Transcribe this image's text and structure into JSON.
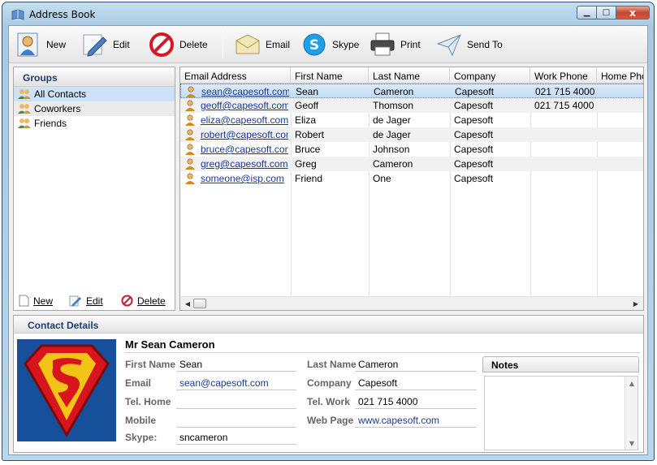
{
  "window": {
    "title": "Address Book"
  },
  "window_controls": {
    "minimize": "▁",
    "maximize": "□",
    "close": "x"
  },
  "toolbar": {
    "new_label": "New",
    "edit_label": "Edit",
    "delete_label": "Delete",
    "email_label": "Email",
    "skype_label": "Skype",
    "print_label": "Print",
    "sendto_label": "Send To"
  },
  "groups": {
    "title": "Groups",
    "items": [
      {
        "label": "All Contacts"
      },
      {
        "label": "Coworkers"
      },
      {
        "label": "Friends"
      }
    ],
    "actions": {
      "new_label": "New",
      "edit_label": "Edit",
      "delete_label": "Delete"
    }
  },
  "contacts": {
    "columns": [
      "Email Address",
      "First Name",
      "Last Name",
      "Company",
      "Work Phone",
      "Home Phone"
    ],
    "rows": [
      {
        "email": "sean@capesoft.com",
        "first": "Sean",
        "last": "Cameron",
        "company": "Capesoft",
        "work": "021 715 4000",
        "home": ""
      },
      {
        "email": "geoff@capesoft.com",
        "first": "Geoff",
        "last": "Thomson",
        "company": "Capesoft",
        "work": "021 715 4000",
        "home": ""
      },
      {
        "email": "eliza@capesoft.com",
        "first": "Eliza",
        "last": "de Jager",
        "company": "Capesoft",
        "work": "",
        "home": ""
      },
      {
        "email": "robert@capesoft.com",
        "first": "Robert",
        "last": "de Jager",
        "company": "Capesoft",
        "work": "",
        "home": ""
      },
      {
        "email": "bruce@capesoft.com",
        "first": "Bruce",
        "last": "Johnson",
        "company": "Capesoft",
        "work": "",
        "home": ""
      },
      {
        "email": "greg@capesoft.com",
        "first": "Greg",
        "last": "Cameron",
        "company": "Capesoft",
        "work": "",
        "home": ""
      },
      {
        "email": "someone@isp.com",
        "first": "Friend",
        "last": "One",
        "company": "Capesoft",
        "work": "",
        "home": ""
      }
    ]
  },
  "details": {
    "title": "Contact Details",
    "full_name": "Mr Sean Cameron",
    "labels": {
      "first_name": "First Name",
      "email": "Email",
      "tel_home": "Tel. Home",
      "mobile": "Mobile",
      "skype": "Skype:",
      "last_name": "Last Name",
      "company": "Company",
      "tel_work": "Tel. Work",
      "web_page": "Web Page"
    },
    "values": {
      "first_name": "Sean",
      "email": "sean@capesoft.com",
      "tel_home": "",
      "mobile": "",
      "skype": "sncameron",
      "last_name": "Cameron",
      "company": "Capesoft",
      "tel_work": "021 715 4000",
      "web_page": "www.capesoft.com"
    },
    "notes_title": "Notes",
    "notes_text": ""
  }
}
